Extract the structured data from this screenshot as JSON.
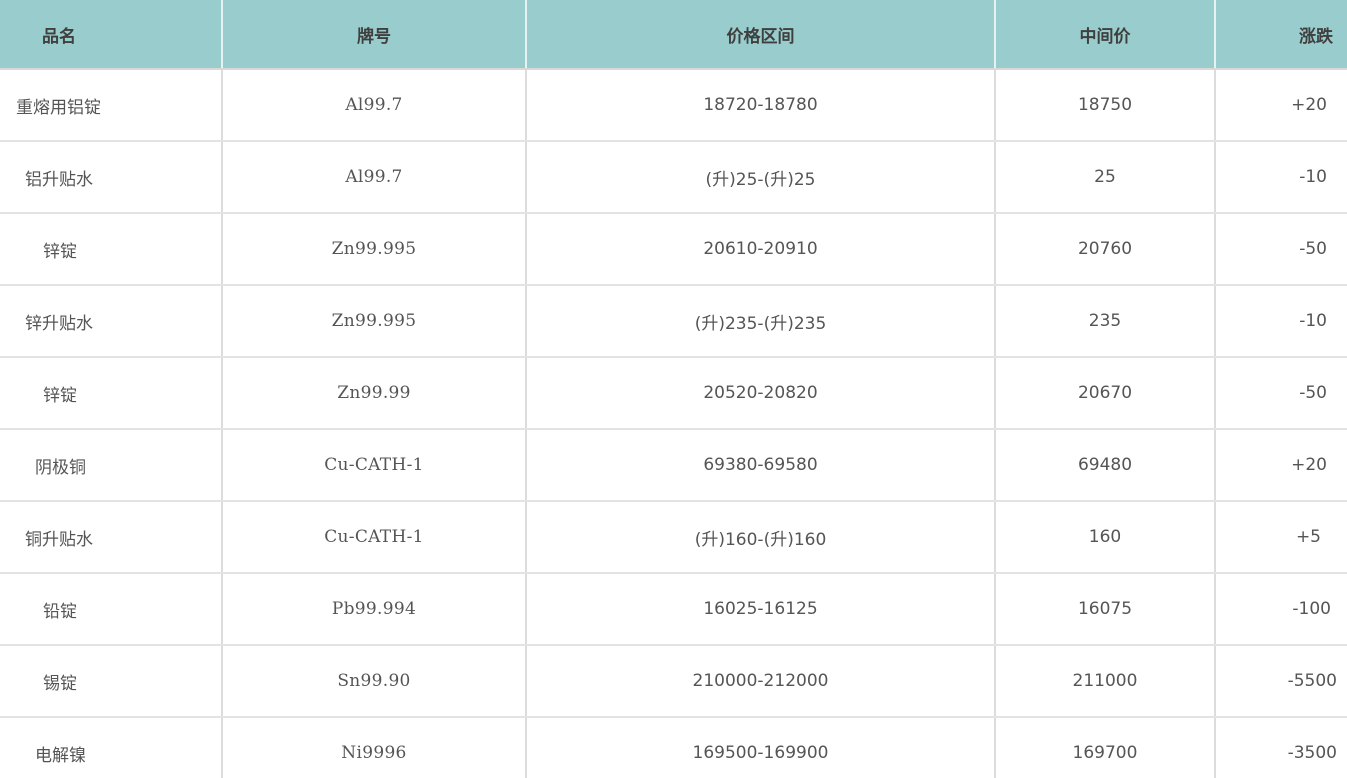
{
  "table": {
    "headers": {
      "name": "品名",
      "grade": "牌号",
      "range": "价格区间",
      "mid": "中间价",
      "change": "涨跌"
    },
    "rows": [
      {
        "name": "重熔用铝锭",
        "grade": "Al99.7",
        "range": "18720-18780",
        "mid": "18750",
        "change": "+20"
      },
      {
        "name": "铝升贴水",
        "grade": "Al99.7",
        "range": "(升)25-(升)25",
        "mid": "25",
        "change": "-10"
      },
      {
        "name": "锌锭",
        "grade": "Zn99.995",
        "range": "20610-20910",
        "mid": "20760",
        "change": "-50"
      },
      {
        "name": "锌升贴水",
        "grade": "Zn99.995",
        "range": "(升)235-(升)235",
        "mid": "235",
        "change": "-10"
      },
      {
        "name": "锌锭",
        "grade": "Zn99.99",
        "range": "20520-20820",
        "mid": "20670",
        "change": "-50"
      },
      {
        "name": "阴极铜",
        "grade": "Cu-CATH-1",
        "range": "69380-69580",
        "mid": "69480",
        "change": "+20"
      },
      {
        "name": "铜升贴水",
        "grade": "Cu-CATH-1",
        "range": "(升)160-(升)160",
        "mid": "160",
        "change": "+5"
      },
      {
        "name": "铅锭",
        "grade": "Pb99.994",
        "range": "16025-16125",
        "mid": "16075",
        "change": "-100"
      },
      {
        "name": "锡锭",
        "grade": "Sn99.90",
        "range": "210000-212000",
        "mid": "211000",
        "change": "-5500"
      },
      {
        "name": "电解镍",
        "grade": "Ni9996",
        "range": "169500-169900",
        "mid": "169700",
        "change": "-3500"
      }
    ]
  },
  "colors": {
    "header_bg": "#99cccc",
    "text": "#555555"
  }
}
